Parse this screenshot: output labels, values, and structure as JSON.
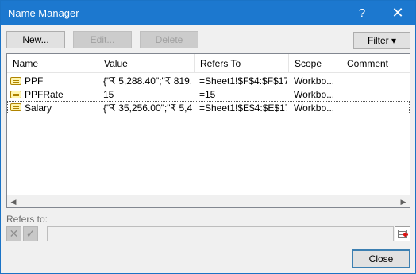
{
  "window": {
    "title": "Name Manager",
    "help_glyph": "?",
    "close_glyph": "✕"
  },
  "toolbar": {
    "new_label": "New...",
    "edit_label": "Edit...",
    "delete_label": "Delete",
    "filter_label": "Filter ▾"
  },
  "table": {
    "columns": [
      "Name",
      "Value",
      "Refers To",
      "Scope",
      "Comment"
    ],
    "rows": [
      {
        "name": "PPF",
        "value": "{\"₹ 5,288.40\";\"₹ 819....",
        "refers_to": "=Sheet1!$F$4:$F$17",
        "scope": "Workbo..."
      },
      {
        "name": "PPFRate",
        "value": "15",
        "refers_to": "=15",
        "scope": "Workbo..."
      },
      {
        "name": "Salary",
        "value": "{\"₹ 35,256.00\";\"₹ 5,4...",
        "refers_to": "=Sheet1!$E$4:$E$17",
        "scope": "Workbo..."
      }
    ],
    "selected_row": 2
  },
  "scrollbar": {
    "left_glyph": "◀",
    "right_glyph": "▶"
  },
  "refers": {
    "label": "Refers to:",
    "cancel_glyph": "✕",
    "confirm_glyph": "✓",
    "value": ""
  },
  "footer": {
    "close_label": "Close"
  },
  "icons": {
    "name_icon": "named-range-icon",
    "range_selector": "collapse-dialog-icon"
  }
}
